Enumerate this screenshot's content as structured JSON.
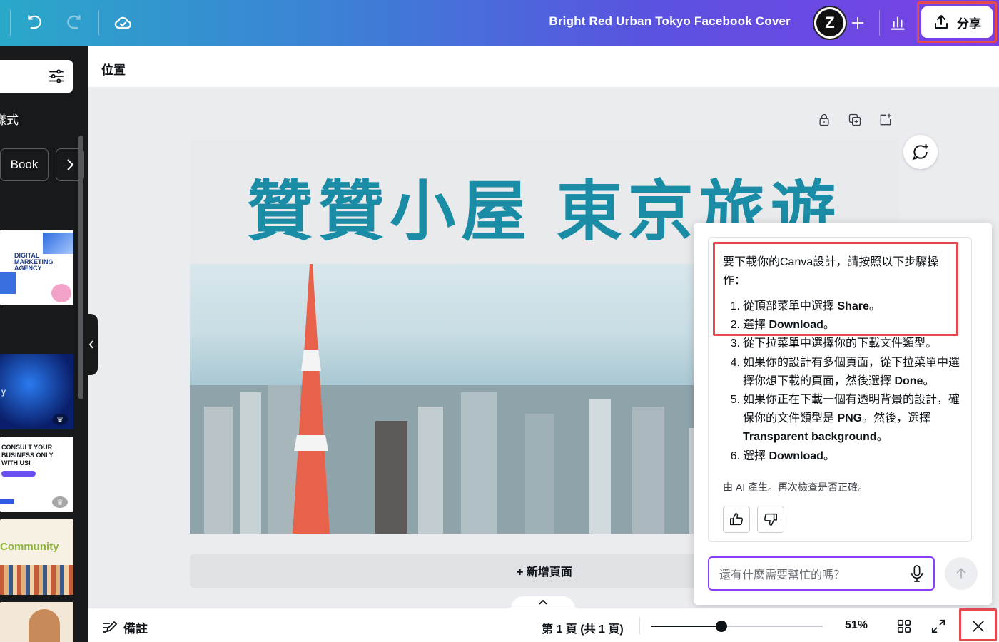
{
  "topbar": {
    "undo_icon": "undo-icon",
    "redo_icon": "redo-icon",
    "cloud_icon": "cloud-check-icon",
    "doc_title": "Bright Red Urban Tokyo Facebook Cover",
    "avatar_letter": "Z",
    "add_icon": "plus-icon",
    "insights_icon": "bar-chart-icon",
    "share_label": "分享",
    "highlight_color": "#e5484d"
  },
  "left_panel": {
    "style_label": "樣式",
    "chip_label": "Book",
    "templates": [
      {
        "text": "DIGITAL MARKETING AGENCY"
      },
      {
        "text": "y"
      },
      {
        "text": "CONSULT YOUR BUSINESS ONLY WITH US!"
      },
      {
        "text": "Community"
      },
      {
        "text": ""
      }
    ]
  },
  "canvas": {
    "position_label": "位置",
    "page_title": "贊贊小屋 東京旅遊",
    "title_color": "#1a8ca6",
    "add_page_label": "+ 新增頁面"
  },
  "ai_panel": {
    "intro": "要下載你的Canva設計，請按照以下步驟操作：",
    "steps": [
      {
        "n": "1.",
        "pre": "從頂部菜單中選擇 ",
        "bold": "Share",
        "post": "。"
      },
      {
        "n": "2.",
        "pre": "選擇 ",
        "bold": "Download",
        "post": "。"
      },
      {
        "n": "3.",
        "pre": "從下拉菜單中選擇你的下載文件類型。",
        "bold": "",
        "post": ""
      },
      {
        "n": "4.",
        "pre": "如果你的設計有多個頁面，從下拉菜單中選擇你想下載的頁面，然後選擇 ",
        "bold": "Done",
        "post": "。"
      },
      {
        "n": "5.",
        "pre": "如果你正在下載一個有透明背景的設計，確保你的文件類型是 ",
        "bold": "PNG",
        "post": "。然後，選擇 ",
        "bold2": "Transparent background",
        "post2": "。"
      },
      {
        "n": "6.",
        "pre": "選擇 ",
        "bold": "Download",
        "post": "。"
      }
    ],
    "note": "由 AI 產生。再次檢查是否正確。",
    "input_placeholder": "還有什麼需要幫忙的嗎？",
    "accent_color": "#8b3dff"
  },
  "bottombar": {
    "notes_label": "備註",
    "page_indicator": "第 1 頁 (共 1 頁)",
    "zoom_fraction": 0.41,
    "zoom_label": "51%"
  }
}
